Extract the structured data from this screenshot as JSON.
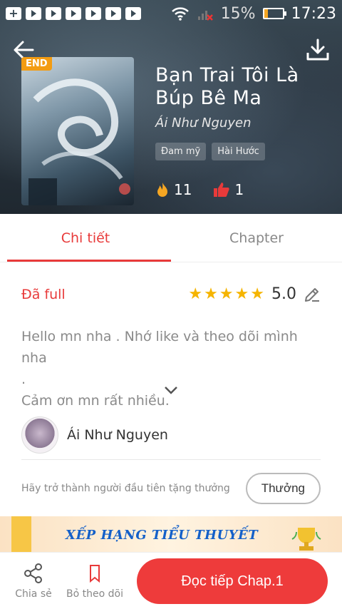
{
  "status_bar": {
    "battery_percent": "15%",
    "time": "17:23"
  },
  "book": {
    "badge": "END",
    "title": "Bạn Trai Tôi Là Búp Bê Ma",
    "author": "Ái Như Nguyen",
    "tags": [
      "Đam mỹ",
      "Hài Hước"
    ],
    "views": "11",
    "likes": "1"
  },
  "tabs": [
    {
      "label": "Chi tiết",
      "active": true
    },
    {
      "label": "Chapter",
      "active": false
    }
  ],
  "detail": {
    "status": "Đã full",
    "rating": "5.0",
    "stars": 5,
    "description_line1": "Hello mn nha . Nhớ like và theo dõi mình nha",
    "description_line2": ".",
    "description_line3": "Cảm ơn mn rất nhiều."
  },
  "author_row": {
    "name": "Ái Như Nguyen"
  },
  "reward": {
    "text": "Hãy trở thành người đầu tiên tặng thưởng",
    "button": "Thưởng"
  },
  "banner": {
    "text": "XẾP HẠNG TIỂU THUYẾT"
  },
  "bottom_bar": {
    "share_label": "Chia sẻ",
    "unfollow_label": "Bỏ theo dõi",
    "read_button": "Đọc tiếp Chap.1"
  },
  "colors": {
    "accent": "#e83a3a",
    "star": "#f5b400",
    "header_bg": "#2b3640"
  }
}
